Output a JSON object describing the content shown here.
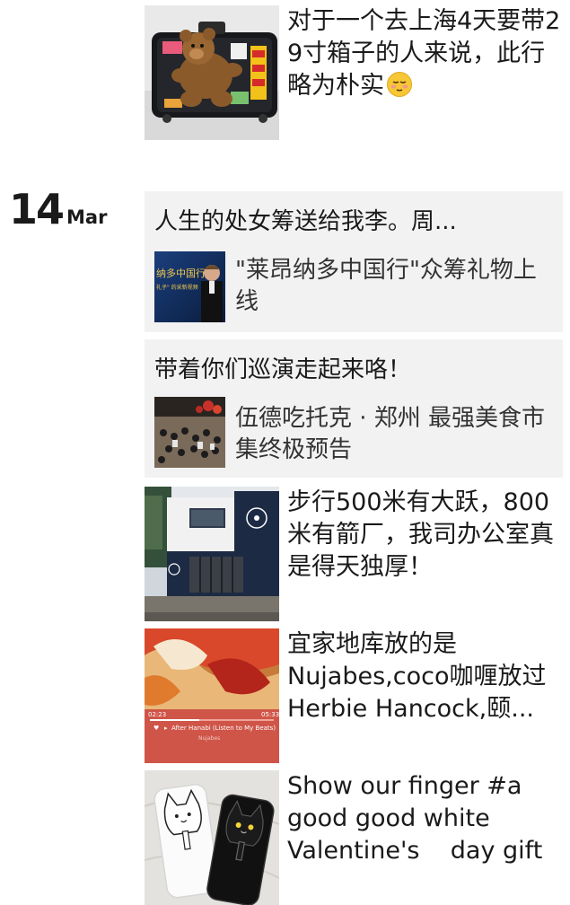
{
  "date": {
    "day": "14",
    "month": "Mar"
  },
  "posts": [
    {
      "caption": "对于一个去上海4天要带29寸箱子的人来说，此行略为朴实",
      "emoji": "pensive-face-emoji"
    },
    {
      "caption": "步行500米有大跃，800米有箭厂，我司办公室真是得天独厚！"
    },
    {
      "caption": "宜家地库放的是Nujabes,coco咖喱放过Herbie Hancock,颐...",
      "player": {
        "time_left": "02:23",
        "time_right": "05:33",
        "track": "After Hanabi (Listen to My Beats)",
        "artist": "Nujabes"
      }
    },
    {
      "caption": "Show our finger #a good good white Valentine's    day gift"
    }
  ],
  "shares": [
    {
      "title": "人生的处女筹送给我李。周...",
      "link_text": "\"莱昂纳多中国行\"众筹礼物上线",
      "thumb_text": "纳多中国行",
      "thumb_subtext": "礼子\" 的采新视频"
    },
    {
      "title": "带着你们巡演走起来咯！",
      "link_text": "伍德吃托克 · 郑州 最强美食市集终极预告"
    }
  ],
  "colors": {
    "share_bg": "#f2f2f2",
    "text": "#1a1a1a",
    "link_text": "#333333"
  }
}
